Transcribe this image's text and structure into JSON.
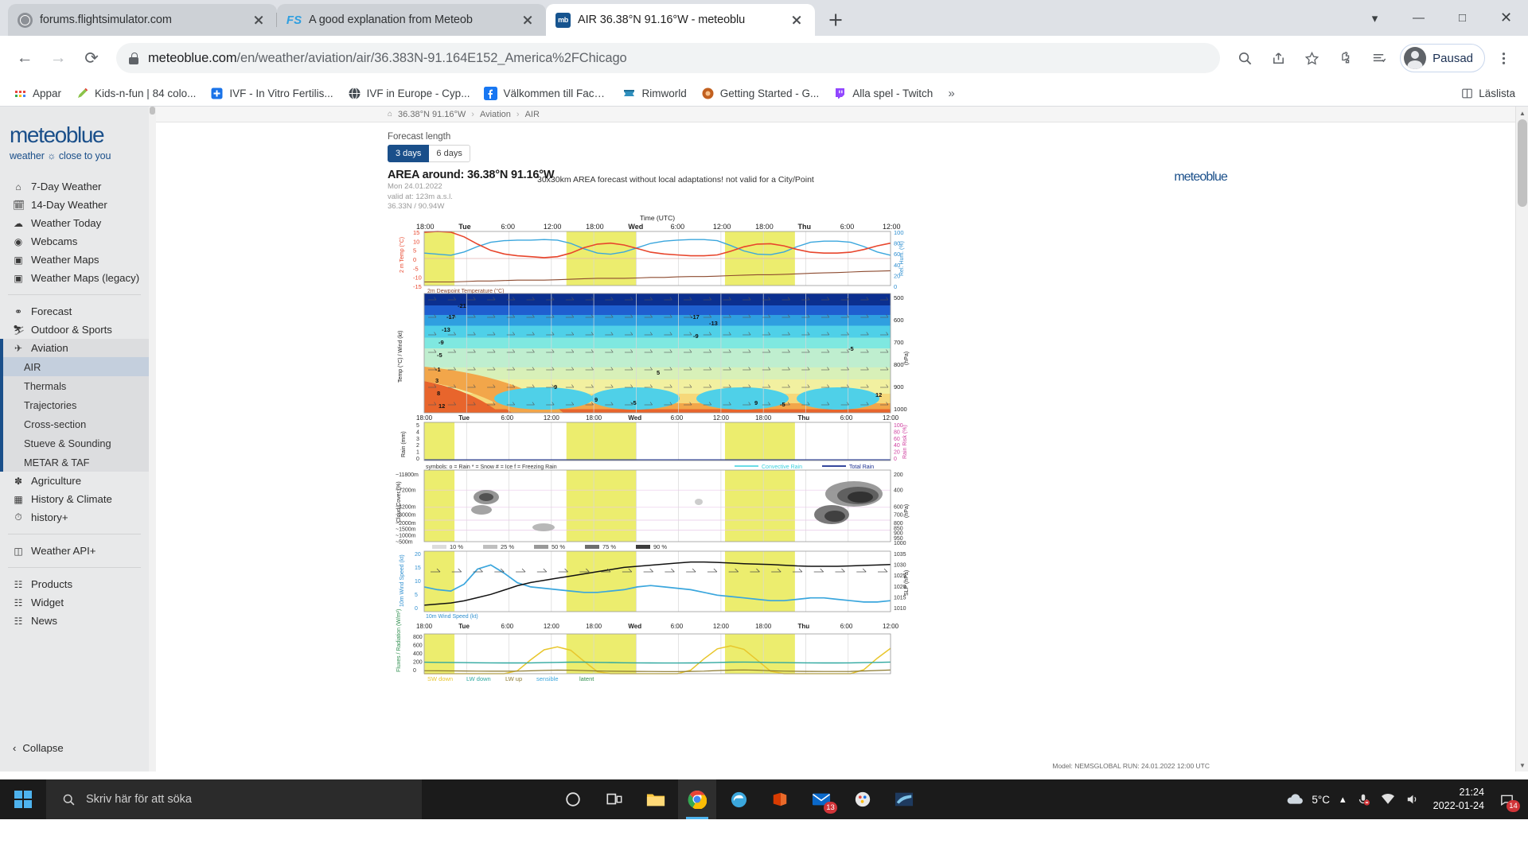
{
  "browser": {
    "tabs": [
      {
        "title": "forums.flightsimulator.com",
        "favicon": "globe-icon",
        "active": false
      },
      {
        "title": "A good explanation from Meteob",
        "favicon": "flightsim-icon",
        "active": false
      },
      {
        "title": "AIR 36.38°N 91.16°W - meteoblu",
        "favicon": "meteoblue-icon",
        "active": true
      }
    ],
    "new_tab_label": "+",
    "window_controls": {
      "minimize": "—",
      "maximize": "☐",
      "close": "✕",
      "more": "⌄"
    },
    "nav": {
      "back": "←",
      "forward": "→",
      "reload": "⟳"
    },
    "url": {
      "domain": "meteoblue.com",
      "path": "/en/weather/aviation/air/36.383N-91.164E152_America%2FChicago",
      "full": "meteoblue.com/en/weather/aviation/air/36.383N-91.164E152_America%2FChicago"
    },
    "toolbar_icons": [
      "zoom-icon",
      "share-icon",
      "bookmark-star-icon",
      "extensions-puzzle-icon",
      "reading-list-icon",
      "browser-menu-icon"
    ],
    "profile_label": "Pausad",
    "bookmarks": [
      {
        "label": "Appar",
        "icon": "apps-grid-icon",
        "color": "#e8453c"
      },
      {
        "label": "Kids-n-fun | 84 colo...",
        "icon": "pencil-icon",
        "color": "#8bc34a"
      },
      {
        "label": "IVF - In Vitro Fertilis...",
        "icon": "plus-square-icon",
        "color": "#1a73e8"
      },
      {
        "label": "IVF in Europe - Cyp...",
        "icon": "globe-dark-icon",
        "color": "#444b52"
      },
      {
        "label": "Välkommen till Face...",
        "icon": "facebook-icon",
        "color": "#1877f2"
      },
      {
        "label": "Rimworld",
        "icon": "rimworld-icon",
        "color": "#2f8fbe"
      },
      {
        "label": "Getting Started - G...",
        "icon": "chrome-orange-icon",
        "color": "#c2601f"
      },
      {
        "label": "Alla spel - Twitch",
        "icon": "twitch-icon",
        "color": "#9146ff"
      }
    ],
    "bookmarks_overflow": "»",
    "reading_list_label": "Läslista"
  },
  "sidebar": {
    "logo": "meteoblue",
    "tagline": "weather ☼ close to you",
    "group1": [
      {
        "label": "7-Day Weather",
        "icon": "home-icon"
      },
      {
        "label": "14-Day Weather",
        "icon": "calendar-14-icon"
      },
      {
        "label": "Weather Today",
        "icon": "weather-today-icon"
      },
      {
        "label": "Webcams",
        "icon": "webcam-icon"
      },
      {
        "label": "Weather Maps",
        "icon": "map-icon"
      },
      {
        "label": "Weather Maps (legacy)",
        "icon": "map-legacy-icon"
      }
    ],
    "group2": [
      {
        "label": "Forecast",
        "icon": "binoculars-icon"
      },
      {
        "label": "Outdoor & Sports",
        "icon": "runner-icon"
      }
    ],
    "aviation": {
      "label": "Aviation",
      "icon": "airplane-icon"
    },
    "aviation_sub": [
      {
        "label": "AIR",
        "active": true
      },
      {
        "label": "Thermals",
        "active": false
      },
      {
        "label": "Trajectories",
        "active": false
      },
      {
        "label": "Cross-section",
        "active": false
      },
      {
        "label": "Stueve & Sounding",
        "active": false
      },
      {
        "label": "METAR & TAF",
        "active": false
      }
    ],
    "group3": [
      {
        "label": "Agriculture",
        "icon": "wheat-icon"
      },
      {
        "label": "History & Climate",
        "icon": "history-chart-icon"
      },
      {
        "label": "history+",
        "icon": "history-plus-icon"
      }
    ],
    "group4": [
      {
        "label": "Weather API+",
        "icon": "api-icon"
      }
    ],
    "group5": [
      {
        "label": "Products",
        "icon": "products-icon"
      },
      {
        "label": "Widget",
        "icon": "widget-icon"
      },
      {
        "label": "News",
        "icon": "news-icon"
      }
    ],
    "collapse_label": "Collapse",
    "collapse_icon": "chevron-left-icon"
  },
  "breadcrumb": {
    "home_icon": "home-icon",
    "items": [
      "36.38°N 91.16°W",
      "Aviation",
      "AIR"
    ],
    "separator": "›"
  },
  "main": {
    "forecast_length_label": "Forecast length",
    "length_options": [
      {
        "label": "3 days",
        "selected": true
      },
      {
        "label": "6 days",
        "selected": false
      }
    ],
    "area_title": "AREA around: 36.38°N 91.16°W",
    "meta_lines": [
      "Mon 24.01.2022",
      "valid at: 123m a.s.l.",
      "36.33N / 90.94W"
    ],
    "disclaimer": "30x30km AREA forecast without local adaptations! not valid for a City/Point",
    "wordmark": "meteoblue",
    "model_footer": "Model: NEMSGLOBAL    RUN: 24.01.2022 12:00 UTC"
  },
  "chart_data": {
    "type": "line",
    "title": "AREA around: 36.38°N 91.16°W",
    "time_axis": {
      "label": "Time (UTC)",
      "ticks": [
        "18:00",
        "Tue",
        "6:00",
        "12:00",
        "18:00",
        "Wed",
        "6:00",
        "12:00",
        "18:00",
        "Thu",
        "6:00",
        "12:00"
      ],
      "bold_ticks": [
        "Tue",
        "Wed",
        "Thu"
      ]
    },
    "night_bands": [
      {
        "start_pct": 0,
        "end_pct": 6.5
      },
      {
        "start_pct": 30.5,
        "end_pct": 45.5
      },
      {
        "start_pct": 64.5,
        "end_pct": 79.5
      }
    ],
    "panels": [
      {
        "name": "temperature-humidity",
        "ylabel_left": "2 m Temp (°C)",
        "yticks_left": [
          15,
          10,
          5,
          0,
          -5,
          -10,
          -15
        ],
        "ylabel_right": "Rel. Hum. (%)",
        "yticks_right": [
          100,
          80,
          60,
          40,
          20,
          0
        ],
        "footnote": "2m Dewpoint Temperature (°C)",
        "series": [
          {
            "name": "2m Temperature",
            "color": "#e8452c",
            "values": [
              14.5,
              15,
              14.6,
              12,
              8,
              4.5,
              2.5,
              1.5,
              1,
              0.5,
              1,
              3,
              6,
              8,
              8.5,
              7.5,
              5.5,
              3.5,
              2.5,
              2,
              1.5,
              1.5,
              2,
              4,
              6.5,
              8,
              8.2,
              7,
              5,
              3.5,
              3,
              3,
              3.5,
              5,
              7,
              8.5
            ]
          },
          {
            "name": "2m Dewpoint Temperature",
            "color": "#8c4a2f",
            "values": [
              -13,
              -13,
              -13,
              -12.8,
              -12.5,
              -12.5,
              -12.2,
              -12,
              -12,
              -12,
              -11.8,
              -11.5,
              -11.2,
              -11,
              -11,
              -11,
              -10.8,
              -10.5,
              -10.5,
              -10.2,
              -10,
              -10,
              -9.8,
              -9.5,
              -9.2,
              -9,
              -9,
              -8.8,
              -8.5,
              -8.2,
              -8,
              -7.8,
              -7.5,
              -7.2,
              -7,
              -6.8
            ]
          },
          {
            "name": "Relative Humidity",
            "color": "#3aa6dd",
            "values": [
              60,
              58,
              56,
              62,
              72,
              80,
              83,
              84,
              84,
              85,
              84,
              78,
              68,
              60,
              58,
              62,
              70,
              78,
              82,
              84,
              85,
              85,
              83,
              74,
              64,
              58,
              57,
              62,
              72,
              80,
              82,
              82,
              80,
              72,
              62,
              56
            ]
          }
        ]
      },
      {
        "name": "upper-air-temp-wind",
        "ylabel_left": "Temp (°C) / Wind (kt)",
        "ylabel_right": "(hPa)",
        "yticks_right": [
          500,
          600,
          700,
          800,
          900,
          1000
        ],
        "isotherm_labels": [
          -21,
          -17,
          -13,
          -9,
          -5,
          -1,
          3,
          8,
          12,
          -17,
          -13,
          -9,
          -5,
          -1,
          5,
          9,
          9,
          5,
          12
        ],
        "colorscale": [
          "#0b2f8f",
          "#1f5fd0",
          "#2f9fe0",
          "#4fd0e8",
          "#7fe8e0",
          "#bfeecf",
          "#d8f0b8",
          "#f2f0a0",
          "#f6d87a",
          "#f2a64a",
          "#e8652c"
        ]
      },
      {
        "name": "rain",
        "ylabel_left": "Rain (mm)",
        "yticks_left": [
          5,
          4,
          3,
          2,
          1,
          0
        ],
        "ylabel_right": "Rain Risk (%)",
        "yticks_right": [
          100,
          80,
          60,
          40,
          20,
          0
        ],
        "symbols_legend": "symbols:      o = Rain          * = Snow          # = Ice          f = Freezing Rain",
        "legend_items": [
          {
            "label": "Convective Rain",
            "color": "#3ad0dd"
          },
          {
            "label": "Total Rain",
            "color": "#1a2f8f"
          }
        ]
      },
      {
        "name": "cloud-cover",
        "ylabel_left": "Cloud Cover (%)",
        "yticks_left": [
          "~11800m",
          "~7200m",
          "~4200m",
          "~3000m",
          "~2000m",
          "~1500m",
          "~1000m",
          "~500m"
        ],
        "ylabel_right": "(hPa)",
        "yticks_right": [
          200,
          400,
          600,
          700,
          800,
          850,
          900,
          950,
          1000
        ],
        "legend": [
          {
            "label": "10 %",
            "color": "#dcdcdc"
          },
          {
            "label": "25 %",
            "color": "#bfbfbf"
          },
          {
            "label": "50 %",
            "color": "#999999"
          },
          {
            "label": "75 %",
            "color": "#6e6e6e"
          },
          {
            "label": "90 %",
            "color": "#3d3d3d"
          }
        ]
      },
      {
        "name": "wind-pressure",
        "ylabel_left": "10m Wind Speed (kt)",
        "yticks_left": [
          20,
          15,
          10,
          5,
          0
        ],
        "ylabel_right": "SLP (hPa)",
        "yticks_right": [
          1035,
          1030,
          1025,
          1020,
          1015,
          1010
        ],
        "footnote": "10m Wind Speed (kt)",
        "series": [
          {
            "name": "Wind Speed",
            "color": "#3aa6dd",
            "values": [
              9,
              8,
              7.5,
              10,
              15.5,
              17,
              14,
              10.5,
              9,
              8.5,
              8,
              7.5,
              7,
              7,
              7.5,
              8,
              9,
              9.5,
              9,
              8.5,
              8,
              7,
              6,
              5.5,
              5,
              4.5,
              4,
              4,
              4.5,
              5,
              5,
              4.5,
              4,
              3.5,
              3.5,
              4
            ]
          },
          {
            "name": "Sea Level Pressure",
            "color": "#111111",
            "values": [
              1011,
              1011.5,
              1012,
              1013,
              1014.5,
              1016,
              1018,
              1020,
              1021.5,
              1022.5,
              1023.5,
              1024.5,
              1025.5,
              1026.5,
              1027.5,
              1028.5,
              1029,
              1029.5,
              1030,
              1030.5,
              1031,
              1031,
              1030.8,
              1030.5,
              1030.2,
              1030,
              1029.8,
              1029.5,
              1029.2,
              1029,
              1029,
              1029,
              1029.2,
              1029.4,
              1029.6,
              1029.8
            ]
          }
        ]
      },
      {
        "name": "fluxes-radiation",
        "ylabel_left": "Fluxes / Radiation (W/m²)",
        "yticks_left": [
          800,
          600,
          400,
          200,
          0
        ],
        "legend": [
          {
            "label": "SW down",
            "color": "#e8c62c"
          },
          {
            "label": "LW down",
            "color": "#2fa8a0"
          },
          {
            "label": "LW up",
            "color": "#8c7a2f"
          },
          {
            "label": "sensible",
            "color": "#3aa6dd"
          },
          {
            "label": "latent",
            "color": "#2f8f4f"
          }
        ],
        "series": [
          {
            "name": "SW down",
            "color": "#e8c62c",
            "values": [
              0,
              0,
              0,
              0,
              0,
              0,
              0,
              60,
              280,
              480,
              540,
              470,
              250,
              40,
              0,
              0,
              0,
              0,
              0,
              0,
              70,
              300,
              500,
              560,
              490,
              270,
              50,
              0,
              0,
              0,
              0,
              0,
              0,
              80,
              310,
              510
            ]
          },
          {
            "name": "LW down",
            "color": "#2fa8a0",
            "values": [
              230,
              228,
              225,
              222,
              220,
              218,
              216,
              216,
              218,
              222,
              228,
              232,
              232,
              228,
              224,
              220,
              218,
              216,
              214,
              214,
              216,
              220,
              226,
              232,
              234,
              230,
              226,
              222,
              220,
              218,
              216,
              216,
              218,
              222,
              228,
              234
            ]
          },
          {
            "name": "LW up",
            "color": "#8c7a2f",
            "values": [
              60,
              58,
              56,
              54,
              52,
              50,
              50,
              52,
              58,
              66,
              72,
              70,
              62,
              55,
              50,
              48,
              46,
              45,
              44,
              44,
              46,
              52,
              62,
              72,
              76,
              70,
              60,
              52,
              48,
              46,
              45,
              45,
              47,
              54,
              64,
              74
            ]
          }
        ]
      }
    ]
  },
  "taskbar": {
    "start_icon": "windows-logo-icon",
    "search_placeholder": "Skriv här för att söka",
    "search_icon": "search-icon",
    "apps": [
      {
        "name": "cortana-icon"
      },
      {
        "name": "task-view-icon"
      },
      {
        "name": "file-explorer-icon"
      },
      {
        "name": "chrome-icon",
        "active": true
      },
      {
        "name": "edge-legacy-icon"
      },
      {
        "name": "office-icon"
      },
      {
        "name": "mail-icon",
        "badge": "13"
      },
      {
        "name": "paint-icon"
      },
      {
        "name": "flightsim-icon"
      }
    ],
    "tray": {
      "weather_icon": "cloud-icon",
      "temperature": "5°C",
      "overflow_icon": "chevron-up-icon",
      "mute_icon": "mic-mute-icon",
      "network_icon": "network-icon",
      "volume_icon": "speaker-icon",
      "time": "21:24",
      "date": "2022-01-24",
      "notification_badge": "14",
      "notification_icon": "notification-icon"
    }
  }
}
